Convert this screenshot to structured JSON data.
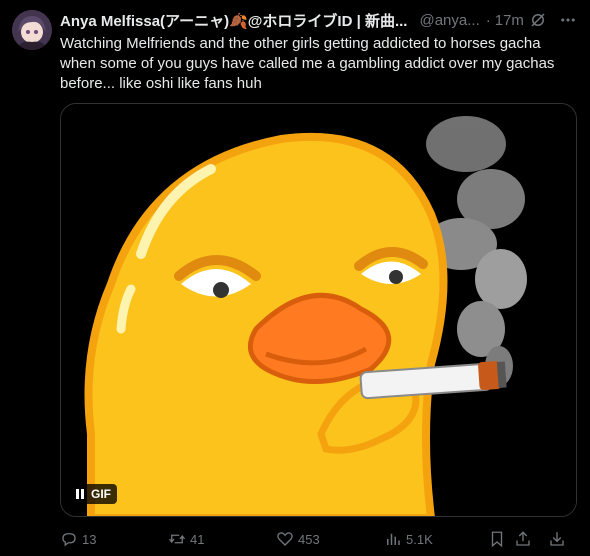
{
  "tweet": {
    "display_name": "Anya Melfissa(アーニャ)🍂@ホロライブID | 新曲...",
    "handle": "@anya...",
    "separator": "·",
    "time": "17m",
    "text": "Watching Melfriends and the other girls getting addicted to horses gacha when some of you guys have called me a gambling addict over my gachas before... like oshi like fans huh"
  },
  "media": {
    "badge_label": "GIF"
  },
  "actions": {
    "replies": "13",
    "reposts": "41",
    "likes": "453",
    "views": "5.1K"
  },
  "icons": {
    "grok": "grok-icon",
    "more": "more-icon",
    "reply": "reply-icon",
    "repost": "repost-icon",
    "like": "heart-icon",
    "views": "views-icon",
    "bookmark": "bookmark-icon",
    "share": "share-icon",
    "download": "download-icon"
  },
  "colors": {
    "background": "#000000",
    "text": "#e7e9ea",
    "muted": "#71767b",
    "duck_yellow": "#fbc31c",
    "duck_orange": "#f5a20f",
    "beak": "#ff7a20"
  }
}
